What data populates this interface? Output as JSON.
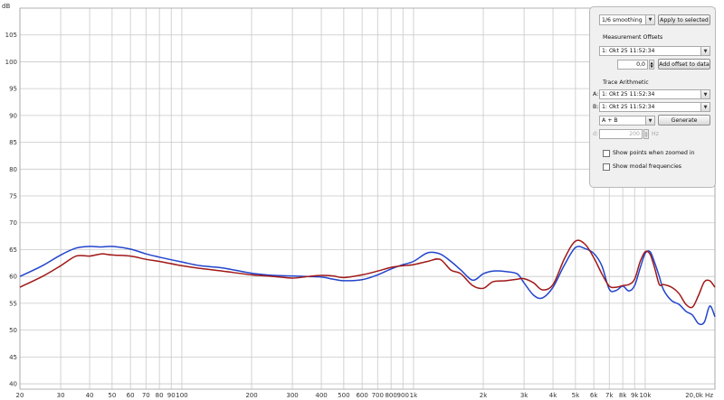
{
  "graph": {
    "y_unit": "dB",
    "x_unit": "Hz",
    "y_ticks": [
      "40",
      "45",
      "50",
      "55",
      "60",
      "65",
      "70",
      "75",
      "80",
      "85",
      "90",
      "95",
      "100",
      "105"
    ],
    "x_ticks": [
      "20",
      "30",
      "40",
      "50",
      "60",
      "70",
      "80",
      "90",
      "100",
      "200",
      "300",
      "400",
      "500",
      "600",
      "700",
      "800",
      "900",
      "1k",
      "2k",
      "3k",
      "4k",
      "5k",
      "6k",
      "7k",
      "8k",
      "9k",
      "10k",
      "20,0k Hz"
    ],
    "colors": {
      "trace_blue": "#2244cc",
      "trace_red": "#a01818",
      "grid": "#c8c8c8"
    }
  },
  "chart_data": {
    "type": "line",
    "xlabel": "Hz",
    "ylabel": "dB",
    "xscale": "log",
    "xlim": [
      20,
      20000
    ],
    "ylim": [
      39,
      110
    ],
    "grid": true,
    "series": [
      {
        "color": "#2244cc",
        "x": [
          20,
          25,
          30,
          35,
          40,
          45,
          50,
          60,
          70,
          80,
          100,
          120,
          150,
          200,
          250,
          300,
          350,
          400,
          450,
          500,
          600,
          700,
          800,
          900,
          1000,
          1150,
          1300,
          1450,
          1600,
          1800,
          2000,
          2200,
          2500,
          2800,
          3000,
          3300,
          3600,
          4000,
          4500,
          5000,
          5500,
          6000,
          6500,
          7000,
          7500,
          8000,
          8500,
          9000,
          9500,
          10000,
          10500,
          11000,
          11500,
          12000,
          13000,
          14000,
          15000,
          16000,
          17000,
          18000,
          19000,
          20000
        ],
        "y": [
          60,
          62,
          64,
          65.3,
          65.6,
          65.5,
          65.6,
          65.1,
          64.2,
          63.6,
          62.7,
          62,
          61.6,
          60.6,
          60.2,
          60.1,
          60,
          59.9,
          59.5,
          59.2,
          59.4,
          60.3,
          61.4,
          62.2,
          62.8,
          64.4,
          64.2,
          62.8,
          61.2,
          59.3,
          60.5,
          61,
          60.9,
          60.5,
          58.8,
          56.5,
          56,
          58,
          62.3,
          65.4,
          65.2,
          64.3,
          62,
          57.6,
          57.4,
          58.2,
          57.3,
          58.3,
          61.5,
          64.3,
          64.6,
          62.5,
          60,
          57.5,
          55.5,
          54.8,
          53.5,
          52.8,
          51.2,
          51.5,
          54.5,
          52.5
        ]
      },
      {
        "color": "#a01818",
        "x": [
          20,
          25,
          30,
          35,
          40,
          45,
          50,
          60,
          70,
          80,
          100,
          120,
          150,
          200,
          250,
          300,
          350,
          400,
          450,
          500,
          600,
          700,
          800,
          900,
          1000,
          1150,
          1300,
          1450,
          1600,
          1800,
          2000,
          2200,
          2500,
          2800,
          3000,
          3300,
          3600,
          4000,
          4500,
          5000,
          5500,
          6000,
          6500,
          7000,
          7500,
          8000,
          8500,
          9000,
          9500,
          10000,
          10500,
          11000,
          11500,
          12000,
          13000,
          14000,
          15000,
          16000,
          17000,
          18000,
          19000,
          20000
        ],
        "y": [
          58,
          60,
          62,
          63.8,
          63.8,
          64.2,
          64,
          63.8,
          63.2,
          62.8,
          62,
          61.5,
          61,
          60.3,
          60,
          59.7,
          60,
          60.2,
          60.1,
          59.8,
          60.3,
          61,
          61.7,
          62,
          62.2,
          62.8,
          63.2,
          61.2,
          60.5,
          58.3,
          57.8,
          59,
          59.2,
          59.5,
          59.6,
          58.8,
          57.5,
          58.5,
          63.5,
          66.6,
          66,
          63.5,
          60.5,
          58.2,
          58,
          58.3,
          58.5,
          59.5,
          62.7,
          64.6,
          64.1,
          61.5,
          58.5,
          58.5,
          58,
          56.8,
          54.8,
          54.3,
          56.5,
          59,
          59.2,
          58
        ]
      }
    ]
  },
  "panel": {
    "smoothing": {
      "value": "1/6 smoothing"
    },
    "apply_button": "Apply to selected",
    "offsets_title": "Measurement Offsets",
    "offset_measurement": "1: Okt 25 11:52:34",
    "offset_value": "0,0",
    "add_offset_button": "Add offset to data",
    "arith_title": "Trace Arithmetic",
    "a_label": "A:",
    "a_value": "1: Okt 25 11:52:34",
    "b_label": "B:",
    "b_value": "1: Okt 25 11:52:34",
    "op_value": "A + B",
    "generate_button": "Generate",
    "d_label": "d:",
    "d_value": "200",
    "d_unit": "Hz",
    "show_points": "Show points when zoomed in",
    "show_modal": "Show modal frequencies"
  }
}
